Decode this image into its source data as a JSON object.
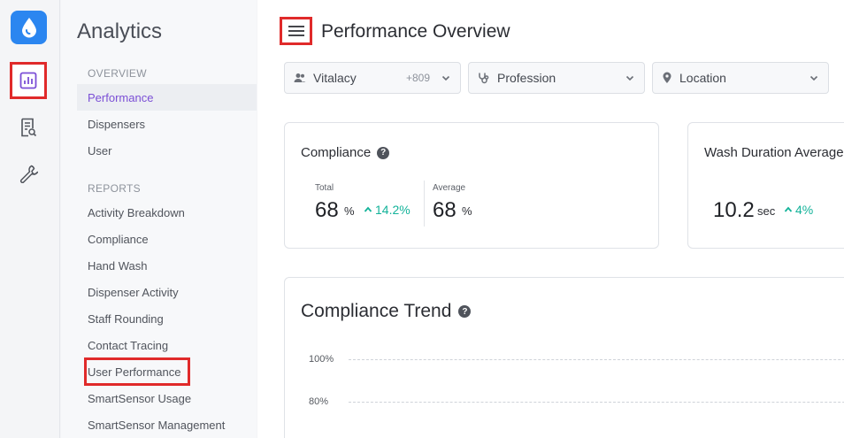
{
  "nav": {
    "title": "Analytics",
    "sections": [
      {
        "label": "OVERVIEW",
        "items": [
          {
            "label": "Performance",
            "active": true
          },
          {
            "label": "Dispensers"
          },
          {
            "label": "User"
          }
        ]
      },
      {
        "label": "REPORTS",
        "items": [
          {
            "label": "Activity Breakdown"
          },
          {
            "label": "Compliance"
          },
          {
            "label": "Hand Wash"
          },
          {
            "label": "Dispenser Activity"
          },
          {
            "label": "Staff Rounding"
          },
          {
            "label": "Contact Tracing"
          },
          {
            "label": "User Performance"
          },
          {
            "label": "SmartSensor Usage"
          },
          {
            "label": "SmartSensor Management"
          }
        ]
      }
    ]
  },
  "header": {
    "title": "Performance Overview"
  },
  "filters": [
    {
      "label": "Vitalacy",
      "count": "+809",
      "icon": "users-icon"
    },
    {
      "label": "Profession",
      "icon": "stethoscope-icon"
    },
    {
      "label": "Location",
      "icon": "location-pin-icon"
    }
  ],
  "compliance": {
    "title": "Compliance",
    "total_label": "Total",
    "total_value": "68",
    "total_unit": "%",
    "total_delta": "14.2%",
    "average_label": "Average",
    "average_value": "68",
    "average_unit": "%"
  },
  "wash": {
    "title": "Wash Duration Average",
    "value": "10.2",
    "unit": "sec",
    "delta": "4%"
  },
  "trend": {
    "title": "Compliance Trend",
    "yticks": [
      "100%",
      "80%"
    ]
  },
  "colors": {
    "accent": "#7b4fd6",
    "positive": "#14b39a",
    "brand": "#2b86f0",
    "highlight": "#e02a2a"
  }
}
